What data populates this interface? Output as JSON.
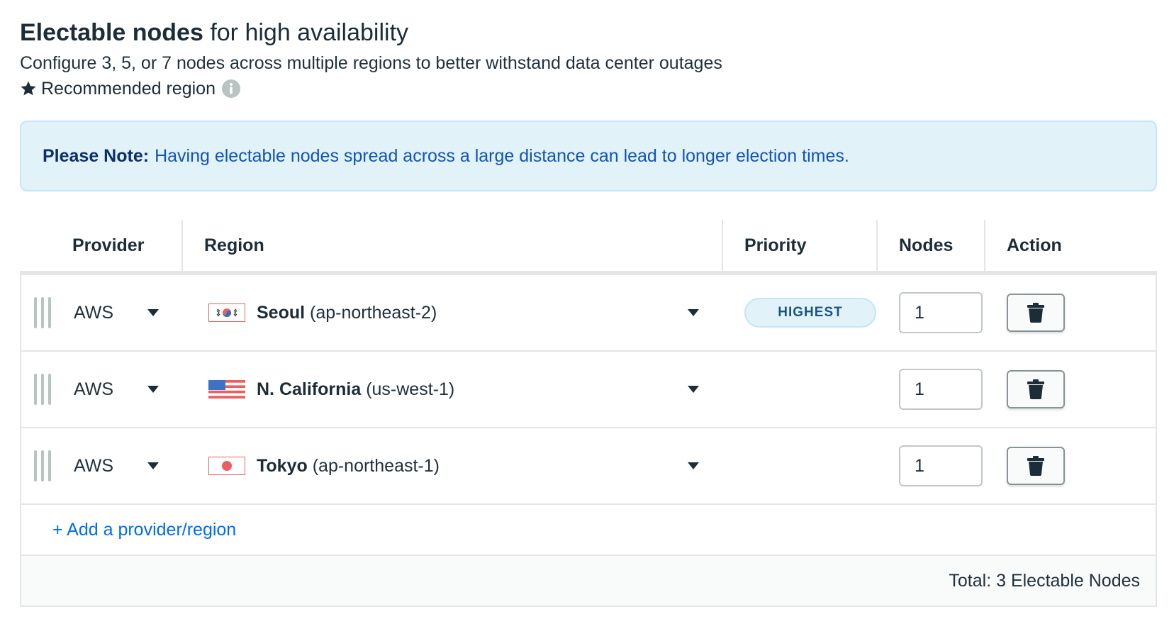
{
  "header": {
    "title_bold": "Electable nodes",
    "title_rest": "for high availability",
    "subtitle": "Configure 3, 5, or 7 nodes across multiple regions to better withstand data center outages",
    "recommended_label": "Recommended region",
    "star_icon": "star-icon",
    "info_icon": "info-icon"
  },
  "note": {
    "label": "Please Note:",
    "text": "Having electable nodes spread across a large distance can lead to longer election times."
  },
  "table": {
    "columns": {
      "provider": "Provider",
      "region": "Region",
      "priority": "Priority",
      "nodes": "Nodes",
      "action": "Action"
    },
    "rows": [
      {
        "provider": "AWS",
        "flag": "south-korea-flag",
        "region_name": "Seoul",
        "region_code": "(ap-northeast-2)",
        "priority": "HIGHEST",
        "nodes": "1"
      },
      {
        "provider": "AWS",
        "flag": "us-flag",
        "region_name": "N. California",
        "region_code": "(us-west-1)",
        "priority": "",
        "nodes": "1"
      },
      {
        "provider": "AWS",
        "flag": "japan-flag",
        "region_name": "Tokyo",
        "region_code": "(ap-northeast-1)",
        "priority": "",
        "nodes": "1"
      }
    ],
    "add_label": "+ Add a provider/region",
    "total_label": "Total: 3 Electable Nodes"
  },
  "colors": {
    "note_bg": "#e1f2f9",
    "note_text": "#1254b7",
    "link": "#016bf8",
    "badge_text": "#1a567e"
  }
}
